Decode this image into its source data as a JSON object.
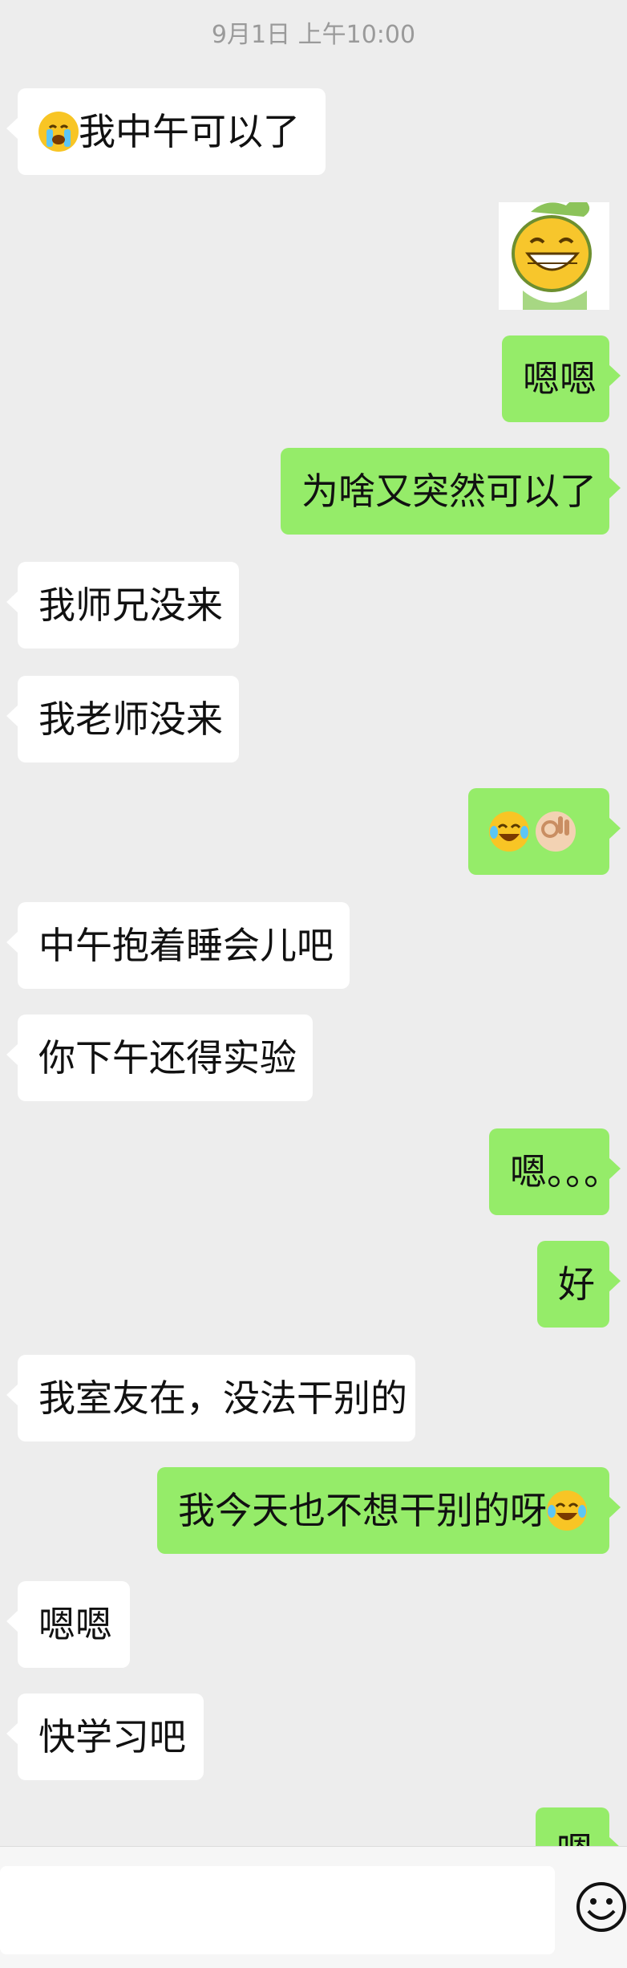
{
  "timestamp": "9月1日 上午10:00",
  "messages": [
    {
      "side": "left",
      "text": "我中午可以了",
      "emoji_before": "crying-face-icon"
    },
    {
      "side": "right",
      "sticker": "smiling-bean-sticker"
    },
    {
      "side": "right",
      "text": "嗯嗯"
    },
    {
      "side": "right",
      "text": "为啥又突然可以了"
    },
    {
      "side": "left",
      "text": "我师兄没来"
    },
    {
      "side": "left",
      "text": "我老师没来"
    },
    {
      "side": "right",
      "emojis": [
        "tears-of-joy-icon",
        "ok-hand-icon"
      ]
    },
    {
      "side": "left",
      "text": "中午抱着睡会儿吧"
    },
    {
      "side": "left",
      "text": "你下午还得实验"
    },
    {
      "side": "right",
      "text": "嗯。。。"
    },
    {
      "side": "right",
      "text": "好"
    },
    {
      "side": "left",
      "text": "我室友在，没法干别的"
    },
    {
      "side": "right",
      "text": "我今天也不想干别的呀",
      "emoji_after": "tears-of-joy-icon"
    },
    {
      "side": "left",
      "text": "嗯嗯"
    },
    {
      "side": "left",
      "text": "快学习吧"
    },
    {
      "side": "right",
      "text": "嗯"
    }
  ],
  "input": {
    "placeholder": ""
  },
  "colors": {
    "background": "#ededed",
    "incoming_bubble": "#ffffff",
    "outgoing_bubble": "#95ec69"
  }
}
